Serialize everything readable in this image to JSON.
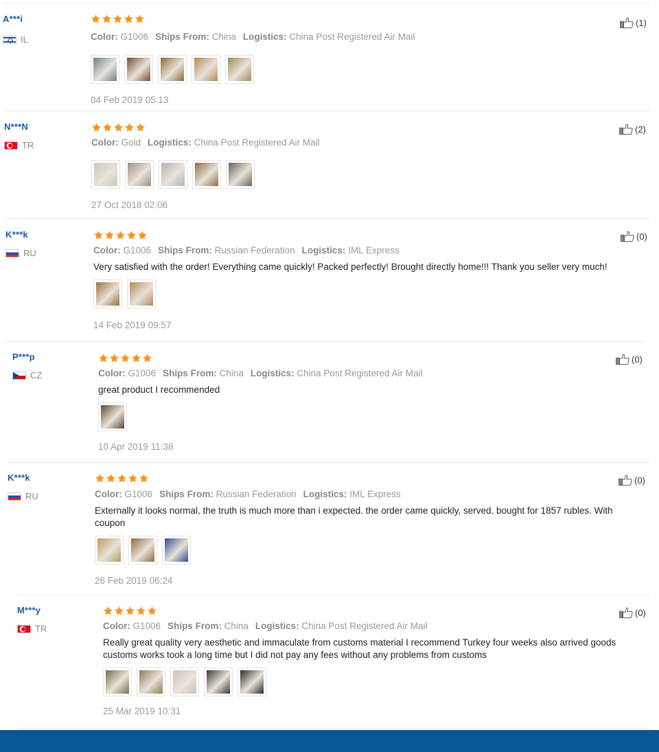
{
  "labels": {
    "color": "Color:",
    "ships_from": "Ships From:",
    "logistics": "Logistics:"
  },
  "colors": {
    "star": "#f7941d",
    "username": "#1d5aa8",
    "footer": "#0a5797"
  },
  "reviews": [
    {
      "user": "A***i",
      "country": "IL",
      "flag": "israel-flag",
      "rating": 5,
      "color": "G1006",
      "ships_from": "China",
      "logistics": "China Post Registered Air Mail",
      "text": "",
      "photos": [
        "#6e7f8c",
        "#7a4a2e",
        "#8a6a3c",
        "#b08a55",
        "#a58a5c"
      ],
      "date": "04 Feb 2019 05:13",
      "helpful": "(1)"
    },
    {
      "user": "N***N",
      "country": "TR",
      "flag": "turkey-flag",
      "rating": 5,
      "color": "Gold",
      "ships_from": "",
      "logistics": "China Post Registered Air Mail",
      "text": "",
      "photos": [
        "#cfc6bb",
        "#9c8f84",
        "#b7b2ad",
        "#8e6d4b",
        "#6b6258"
      ],
      "date": "27 Oct 2018 02:06",
      "helpful": "(2)"
    },
    {
      "user": "K***k",
      "country": "RU",
      "flag": "russia-flag",
      "rating": 5,
      "color": "G1006",
      "ships_from": "Russian Federation",
      "logistics": "IML Express",
      "text": "Very satisfied with the order! Everything came quickly! Packed perfectly! Brought directly home!!! Thank you seller very much!",
      "photos": [
        "#9a6f42",
        "#b3875a"
      ],
      "date": "14 Feb 2019 09:57",
      "helpful": "(0)"
    },
    {
      "user": "P***p",
      "country": "CZ",
      "flag": "czech-flag",
      "rating": 5,
      "color": "G1006",
      "ships_from": "China",
      "logistics": "China Post Registered Air Mail",
      "text": "great product I recommended",
      "photos": [
        "#5c4a38"
      ],
      "date": "10 Apr 2019 11:38",
      "helpful": "(0)"
    },
    {
      "user": "K***k",
      "country": "RU",
      "flag": "russia-flag",
      "rating": 5,
      "color": "G1006",
      "ships_from": "Russian Federation",
      "logistics": "IML Express",
      "text": "Externally it looks normal, the truth is much more than i expected. the order came quickly, served. bought for 1857 rubles. With coupon",
      "photos": [
        "#b89a63",
        "#8d6a45",
        "#2f4f8a"
      ],
      "date": "26 Feb 2019 06:24",
      "helpful": "(0)"
    },
    {
      "user": "M***y",
      "country": "TR",
      "flag": "turkey-flag",
      "rating": 5,
      "color": "G1006",
      "ships_from": "China",
      "logistics": "China Post Registered Air Mail",
      "text": "Really great quality very aesthetic and immaculate from customs material I recommend Turkey four weeks also arrived goods customs works took a long time but I did not pay any fees without any problems from customs",
      "photos": [
        "#7d6a4e",
        "#8f7a55",
        "#c9c4bd",
        "#3a3a3a",
        "#2b2b2b"
      ],
      "date": "25 Mar 2019 10:31",
      "helpful": "(0)"
    }
  ]
}
